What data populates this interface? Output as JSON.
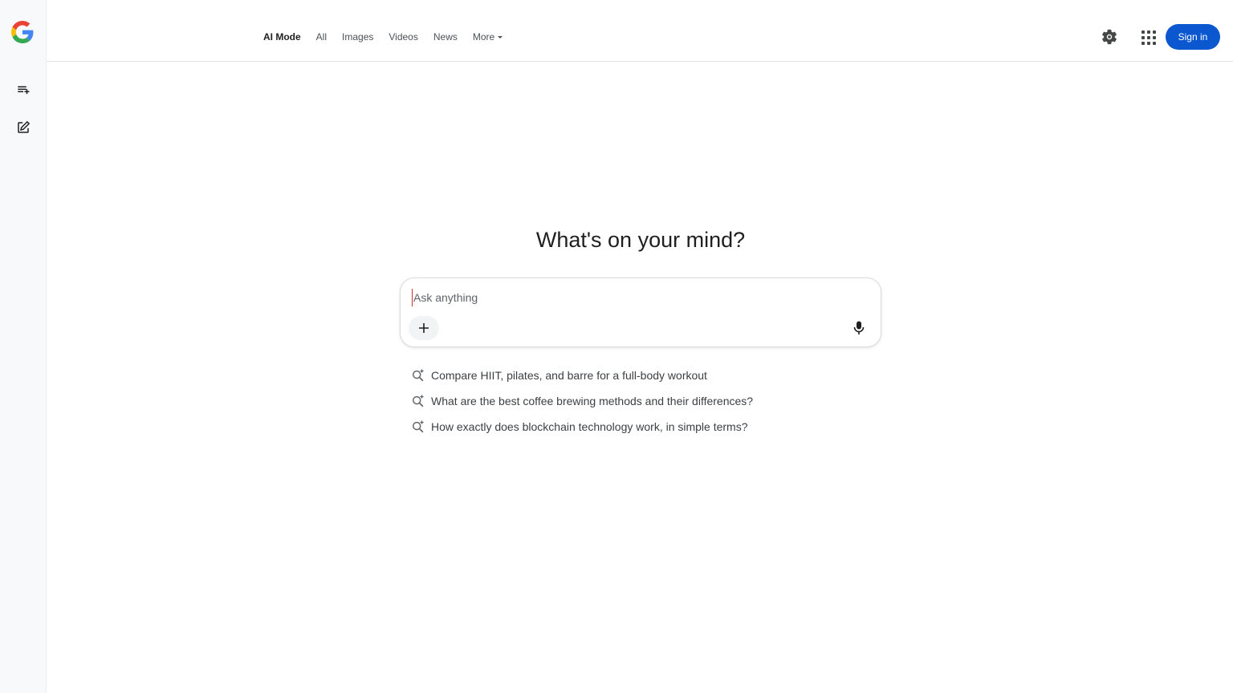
{
  "header": {
    "tabs": [
      {
        "label": "AI Mode",
        "active": true
      },
      {
        "label": "All"
      },
      {
        "label": "Images"
      },
      {
        "label": "Videos"
      },
      {
        "label": "News"
      },
      {
        "label": "More"
      }
    ],
    "sign_in_label": "Sign in",
    "icons": {
      "settings": "gear-icon",
      "apps": "apps-grid-icon"
    }
  },
  "sidebar": {
    "icons": [
      "google-logo",
      "playlist-add-icon",
      "edit-icon"
    ]
  },
  "main": {
    "headline": "What's on your mind?",
    "search": {
      "placeholder": "Ask anything",
      "value": ""
    },
    "suggestions": [
      "Compare HIIT, pilates, and barre for a full-body workout",
      "What are the best coffee brewing methods and their differences?",
      "How exactly does blockchain technology work, in simple terms?"
    ]
  },
  "colors": {
    "accent": "#0b57d0",
    "sidebar_bg": "#f8f9fa",
    "cursor": "#d93025"
  }
}
